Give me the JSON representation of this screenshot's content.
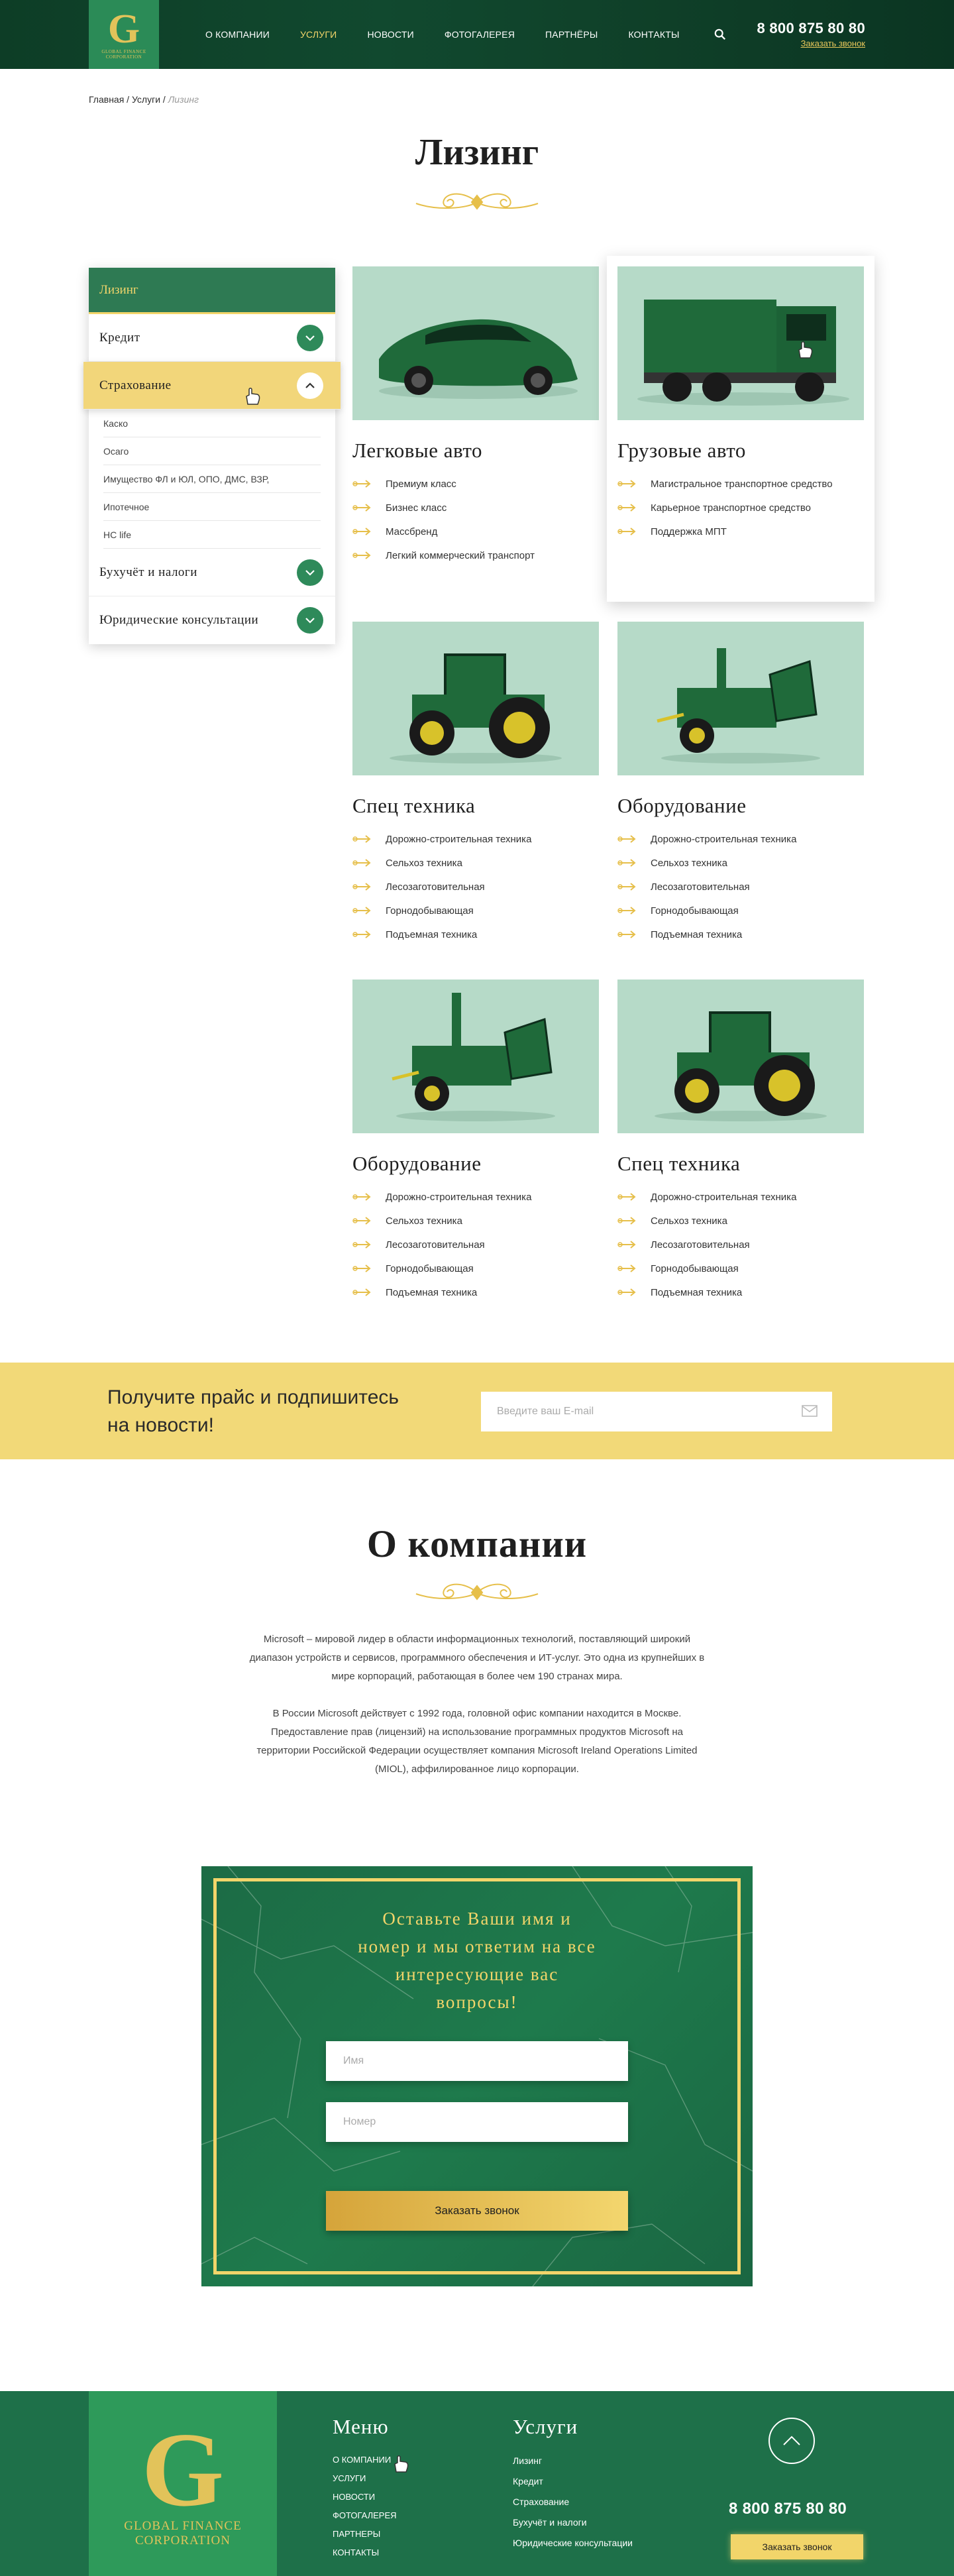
{
  "header": {
    "logo_letter": "G",
    "logo_text": "GLOBAL FINANCE CORPORATION",
    "nav": [
      {
        "label": "О компании",
        "active": false
      },
      {
        "label": "Услуги",
        "active": true
      },
      {
        "label": "Новости",
        "active": false
      },
      {
        "label": "Фотогалерея",
        "active": false
      },
      {
        "label": "Партнёры",
        "active": false
      },
      {
        "label": "Контакты",
        "active": false
      }
    ],
    "phone": "8 800 875 80 80",
    "callback_link": "Заказать звонок"
  },
  "breadcrumb": {
    "home": "Главная",
    "sep1": " / ",
    "services": "Услуги",
    "sep2": " / ",
    "current": "Лизинг"
  },
  "page_title": "Лизинг",
  "sidebar": {
    "active_head": "Лизинг",
    "items": [
      {
        "label": "Кредит"
      },
      {
        "label": "Страхование"
      },
      {
        "label": "Бухучёт и налоги"
      },
      {
        "label": "Юридические консультации"
      }
    ],
    "sub_items": [
      "Каско",
      "Осаго",
      "Имущество ФЛ и ЮЛ, ОПО, ДМС, ВЗР,",
      "Ипотечное",
      "НС life"
    ]
  },
  "cards": [
    {
      "title": "Легковые авто",
      "items": [
        "Премиум класс",
        "Бизнес класс",
        "Массбренд",
        "Легкий коммерческий транспорт"
      ]
    },
    {
      "title": "Грузовые авто",
      "items": [
        "Магистральное транспортное средство",
        "Карьерное транспортное средство",
        "Поддержка МПТ"
      ]
    },
    {
      "title": "Спец техника",
      "items": [
        "Дорожно-строительная техника",
        "Сельхоз техника",
        "Лесозаготовительная",
        "Горнодобывающая",
        "Подъемная техника"
      ]
    },
    {
      "title": "Оборудование",
      "items": [
        "Дорожно-строительная техника",
        "Сельхоз техника",
        "Лесозаготовительная",
        "Горнодобывающая",
        "Подъемная техника"
      ]
    },
    {
      "title": "Оборудование",
      "items": [
        "Дорожно-строительная техника",
        "Сельхоз техника",
        "Лесозаготовительная",
        "Горнодобывающая",
        "Подъемная техника"
      ]
    },
    {
      "title": "Спец техника",
      "items": [
        "Дорожно-строительная техника",
        "Сельхоз техника",
        "Лесозаготовительная",
        "Горнодобывающая",
        "Подъемная техника"
      ]
    }
  ],
  "subscribe": {
    "line1": "Получите прайс и подпишитесь",
    "line2": "на новости!",
    "placeholder": "Введите ваш E-mail"
  },
  "about": {
    "title": "О компании",
    "p1_l1": "Microsoft – мировой лидер в области информационных технологий, поставляющий широкий",
    "p1_l2": "диапазон устройств и сервисов, программного обеспечения и ИТ-услуг. Это одна из крупнейших в",
    "p1_l3": "мире корпораций, работающая в более чем 190 странах мира.",
    "p2_l1": "В России Microsoft действует с 1992 года, головной офис компании находится в Москве.",
    "p2_l2": "Предоставление прав (лицензий) на использование программных продуктов Microsoft на",
    "p2_l3": "территории Российской Федерации осуществляет компания Microsoft Ireland Operations Limited",
    "p2_l4": "(MIOL), аффилированное лицо корпорации."
  },
  "callback_form": {
    "l1": "Оставьте Ваши имя и",
    "l2": "номер и мы ответим на все",
    "l3": "интересующие вас",
    "l4": "вопросы!",
    "name_placeholder": "Имя",
    "phone_placeholder": "Номер",
    "submit": "Заказать звонок"
  },
  "footer": {
    "logo_letter": "G",
    "logo_l1": "GLOBAL FINANCE",
    "logo_l2": "CORPORATION",
    "menu_title": "Меню",
    "menu": [
      "О компании",
      "Услуги",
      "Новости",
      "Фотогалерея",
      "Партнеры",
      "Контакты"
    ],
    "services_title": "Услуги",
    "services": [
      "Лизинг",
      "Кредит",
      "Страхование",
      "Бухучёт и налоги",
      "Юридические консультации"
    ],
    "phone": "8 800 875 80 80",
    "callback": "Заказать звонок"
  },
  "colors": {
    "brand_green": "#1e7049",
    "accent_gold": "#f2d56a",
    "card_bg": "#b6dac8"
  }
}
